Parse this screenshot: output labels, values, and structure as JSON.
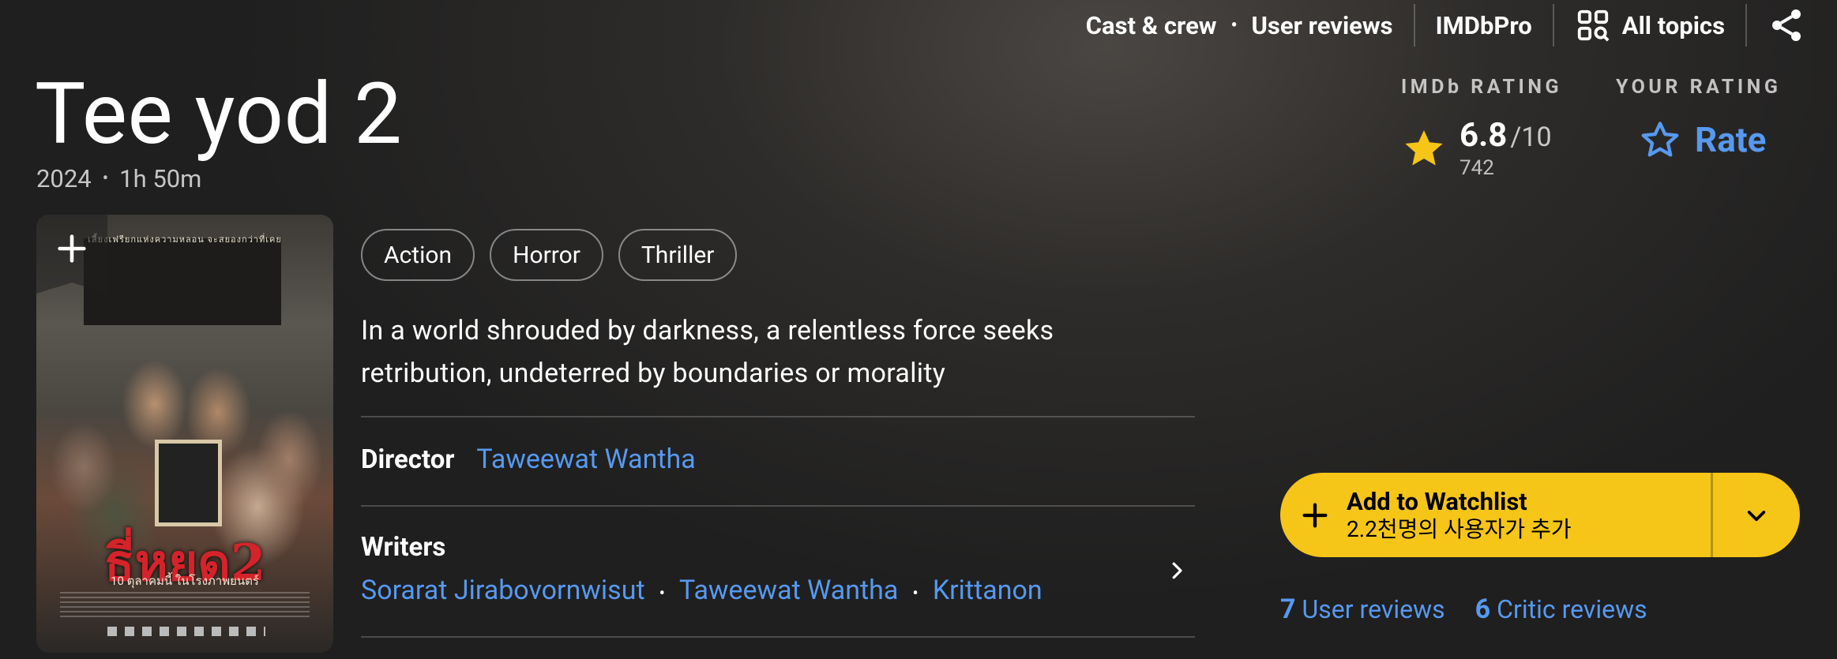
{
  "nav": {
    "cast_crew": "Cast & crew",
    "user_reviews": "User reviews",
    "imdbpro": "IMDbPro",
    "all_topics": "All topics"
  },
  "title": "Tee yod 2",
  "meta": {
    "year": "2024",
    "runtime": "1h 50m"
  },
  "imdb_rating": {
    "label": "IMDb RATING",
    "score": "6.8",
    "max": "/10",
    "votes": "742"
  },
  "your_rating": {
    "label": "YOUR RATING",
    "rate": "Rate"
  },
  "poster": {
    "tagline": "เลี้ยงเฟรียกแห่งความหลอน จะสยองกว่าที่เคย",
    "title": "ธี่หยด2",
    "date": "10 ตุลาคมนี้ ในโรงภาพยนตร์"
  },
  "genres": [
    "Action",
    "Horror",
    "Thriller"
  ],
  "plot": "In a world shrouded by darkness, a relentless force seeks retribution, undeterred by boundaries or morality",
  "director": {
    "label": "Director",
    "name": "Taweewat Wantha"
  },
  "writers": {
    "label": "Writers",
    "names": [
      "Sorarat Jirabovornwisut",
      "Taweewat Wantha",
      "Krittanon"
    ]
  },
  "watchlist": {
    "title": "Add to Watchlist",
    "subtitle": "2.2천명의 사용자가 추가"
  },
  "reviews": {
    "user_count": "7",
    "user_label": "User reviews",
    "critic_count": "6",
    "critic_label": "Critic reviews"
  },
  "colors": {
    "accent_yellow": "#f5c518",
    "link_blue": "#5799ef",
    "background": "#1f1f1f"
  }
}
